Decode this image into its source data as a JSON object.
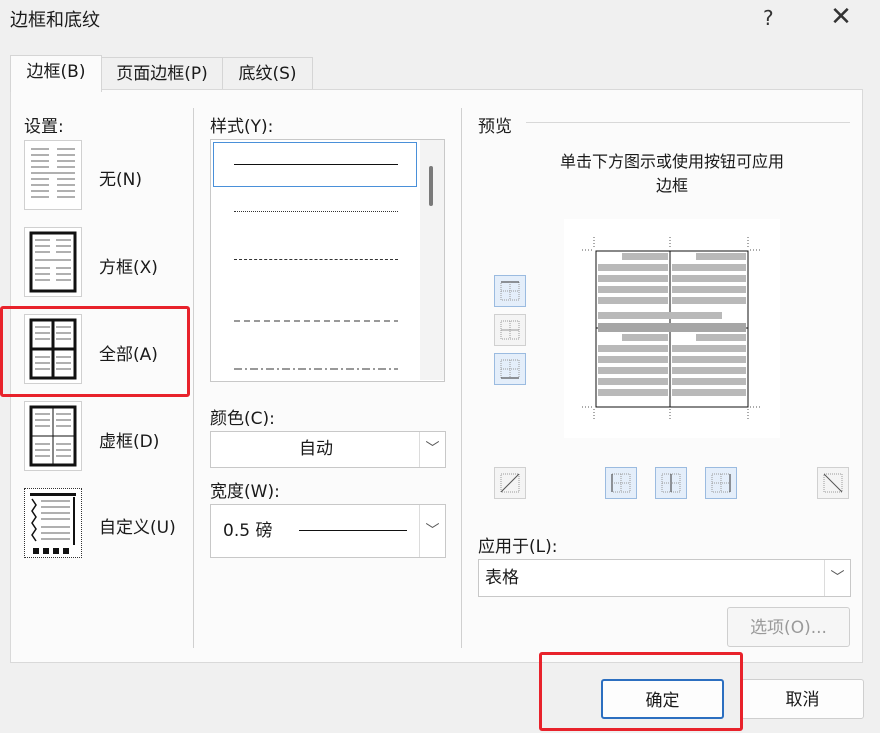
{
  "dialog": {
    "title": "边框和底纹",
    "help": "?",
    "close": "✕"
  },
  "tabs": [
    {
      "label": "边框(B)"
    },
    {
      "label": "页面边框(P)"
    },
    {
      "label": "底纹(S)"
    }
  ],
  "settings": {
    "label": "设置:",
    "items": [
      {
        "label": "无(N)"
      },
      {
        "label": "方框(X)"
      },
      {
        "label": "全部(A)"
      },
      {
        "label": "虚框(D)"
      },
      {
        "label": "自定义(U)"
      }
    ],
    "selected": "全部(A)"
  },
  "style": {
    "label": "样式(Y):"
  },
  "color": {
    "label": "颜色(C):",
    "value": "自动"
  },
  "width": {
    "label": "宽度(W):",
    "value": "0.5 磅"
  },
  "preview": {
    "label": "预览",
    "hint_line1": "单击下方图示或使用按钮可应用",
    "hint_line2": "边框"
  },
  "apply_to": {
    "label": "应用于(L):",
    "value": "表格"
  },
  "buttons": {
    "options": "选项(O)...",
    "ok": "确定",
    "cancel": "取消"
  },
  "colors": {
    "accent": "#2c6fc0",
    "highlight": "#e8222b"
  }
}
